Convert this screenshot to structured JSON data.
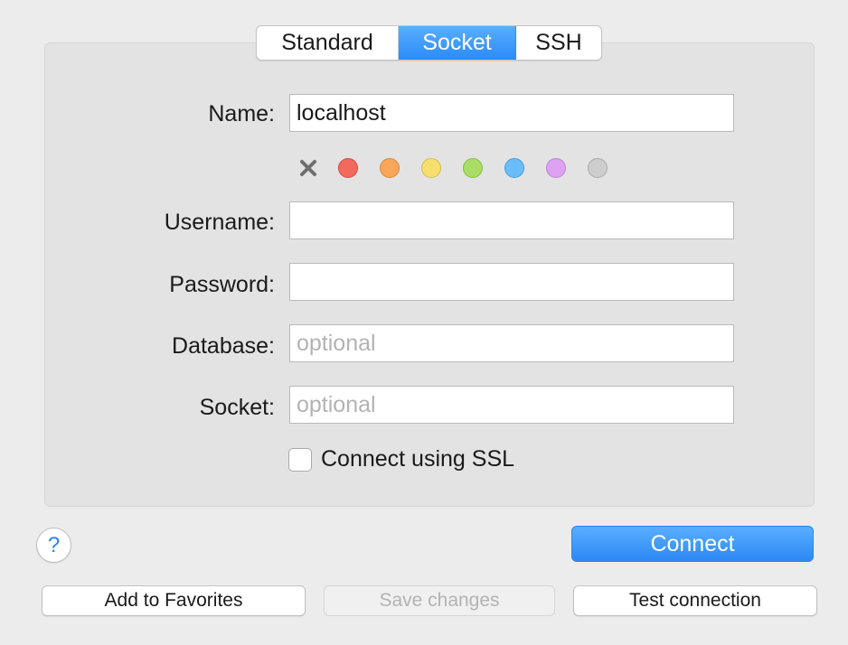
{
  "tabs": [
    {
      "label": "Standard",
      "active": false
    },
    {
      "label": "Socket",
      "active": true
    },
    {
      "label": "SSH",
      "active": false
    }
  ],
  "form": {
    "name_label": "Name:",
    "name_value": "localhost",
    "username_label": "Username:",
    "username_value": "",
    "password_label": "Password:",
    "password_value": "",
    "database_label": "Database:",
    "database_placeholder": "optional",
    "socket_label": "Socket:",
    "socket_placeholder": "optional",
    "ssl_label": "Connect using SSL",
    "ssl_checked": false
  },
  "colors": {
    "swatches": [
      {
        "name": "red",
        "fill": "#f26a5c",
        "stroke": "#d24f43"
      },
      {
        "name": "orange",
        "fill": "#f9a65a",
        "stroke": "#d9893f"
      },
      {
        "name": "yellow",
        "fill": "#f7df6e",
        "stroke": "#d4bc4c"
      },
      {
        "name": "green",
        "fill": "#a9dd66",
        "stroke": "#88bd47"
      },
      {
        "name": "blue",
        "fill": "#6bbcfb",
        "stroke": "#4b9cdb"
      },
      {
        "name": "purple",
        "fill": "#dda2f1",
        "stroke": "#bd82d1"
      },
      {
        "name": "gray",
        "fill": "#cdcdcd",
        "stroke": "#a8a8a8"
      }
    ],
    "accent": "#2a8bf8"
  },
  "buttons": {
    "help_label": "?",
    "connect_label": "Connect",
    "add_favorites_label": "Add to Favorites",
    "save_changes_label": "Save changes",
    "test_connection_label": "Test connection"
  }
}
